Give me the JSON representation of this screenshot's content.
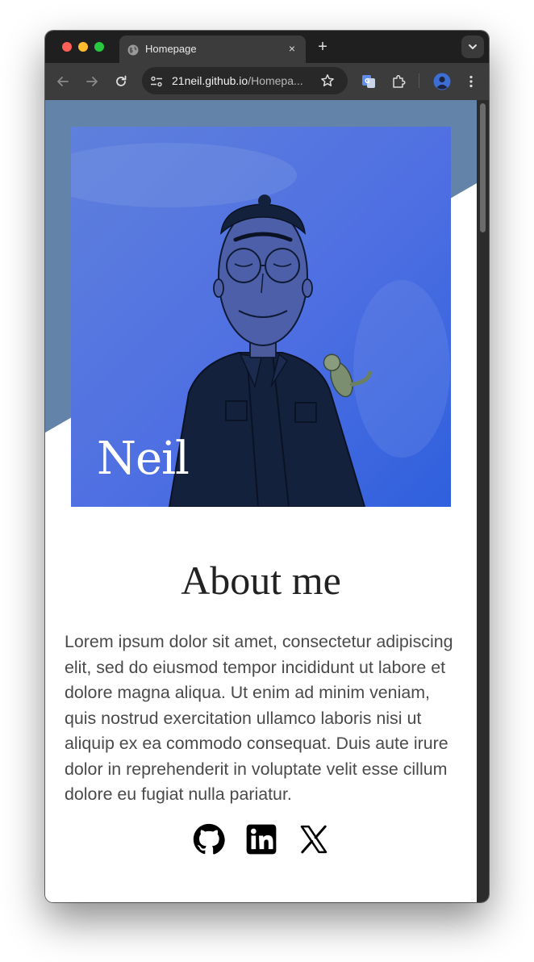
{
  "browser": {
    "tab_title": "Homepage",
    "new_tab_label": "+",
    "tab_close_label": "×",
    "url_host": "21neil.github.io",
    "url_path": "/Homepa..."
  },
  "hero": {
    "name": "Neil"
  },
  "about": {
    "heading": "About me",
    "bio": "Lorem ipsum dolor sit amet, consectetur adipiscing elit, sed do eiusmod tempor incididunt ut labore et dolore magna aliqua. Ut enim ad minim veniam, quis nostrud exercitation ullamco laboris nisi ut aliquip ex ea commodo consequat. Duis aute irure dolor in reprehenderit in voluptate velit esse cillum dolore eu fugiat nulla pariatur."
  },
  "socials": [
    {
      "icon": "github-icon"
    },
    {
      "icon": "linkedin-icon"
    },
    {
      "icon": "x-icon"
    }
  ],
  "colors": {
    "hero_band": "#6483a8",
    "hero_blue": "#4a6fe0",
    "text": "#4a4a4a"
  }
}
